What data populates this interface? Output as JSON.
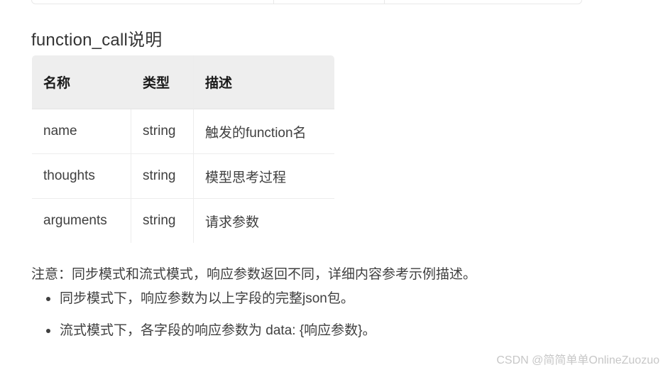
{
  "section": {
    "title": "function_call说明"
  },
  "table": {
    "headers": [
      "名称",
      "类型",
      "描述"
    ],
    "rows": [
      {
        "name": "name",
        "type": "string",
        "desc": "触发的function名"
      },
      {
        "name": "thoughts",
        "type": "string",
        "desc": "模型思考过程"
      },
      {
        "name": "arguments",
        "type": "string",
        "desc": "请求参数"
      }
    ]
  },
  "note": "注意：同步模式和流式模式，响应参数返回不同，详细内容参考示例描述。",
  "bullets": [
    "同步模式下，响应参数为以上字段的完整json包。",
    "流式模式下，各字段的响应参数为 data: {响应参数}。"
  ],
  "watermark": "CSDN @简简单单OnlineZuozuo",
  "colors": {
    "text": "#3f3f3f",
    "heading": "#333333",
    "table_header_bg": "#eeeeee",
    "table_border": "#e4e4e4",
    "watermark": "#c7c7c7"
  }
}
